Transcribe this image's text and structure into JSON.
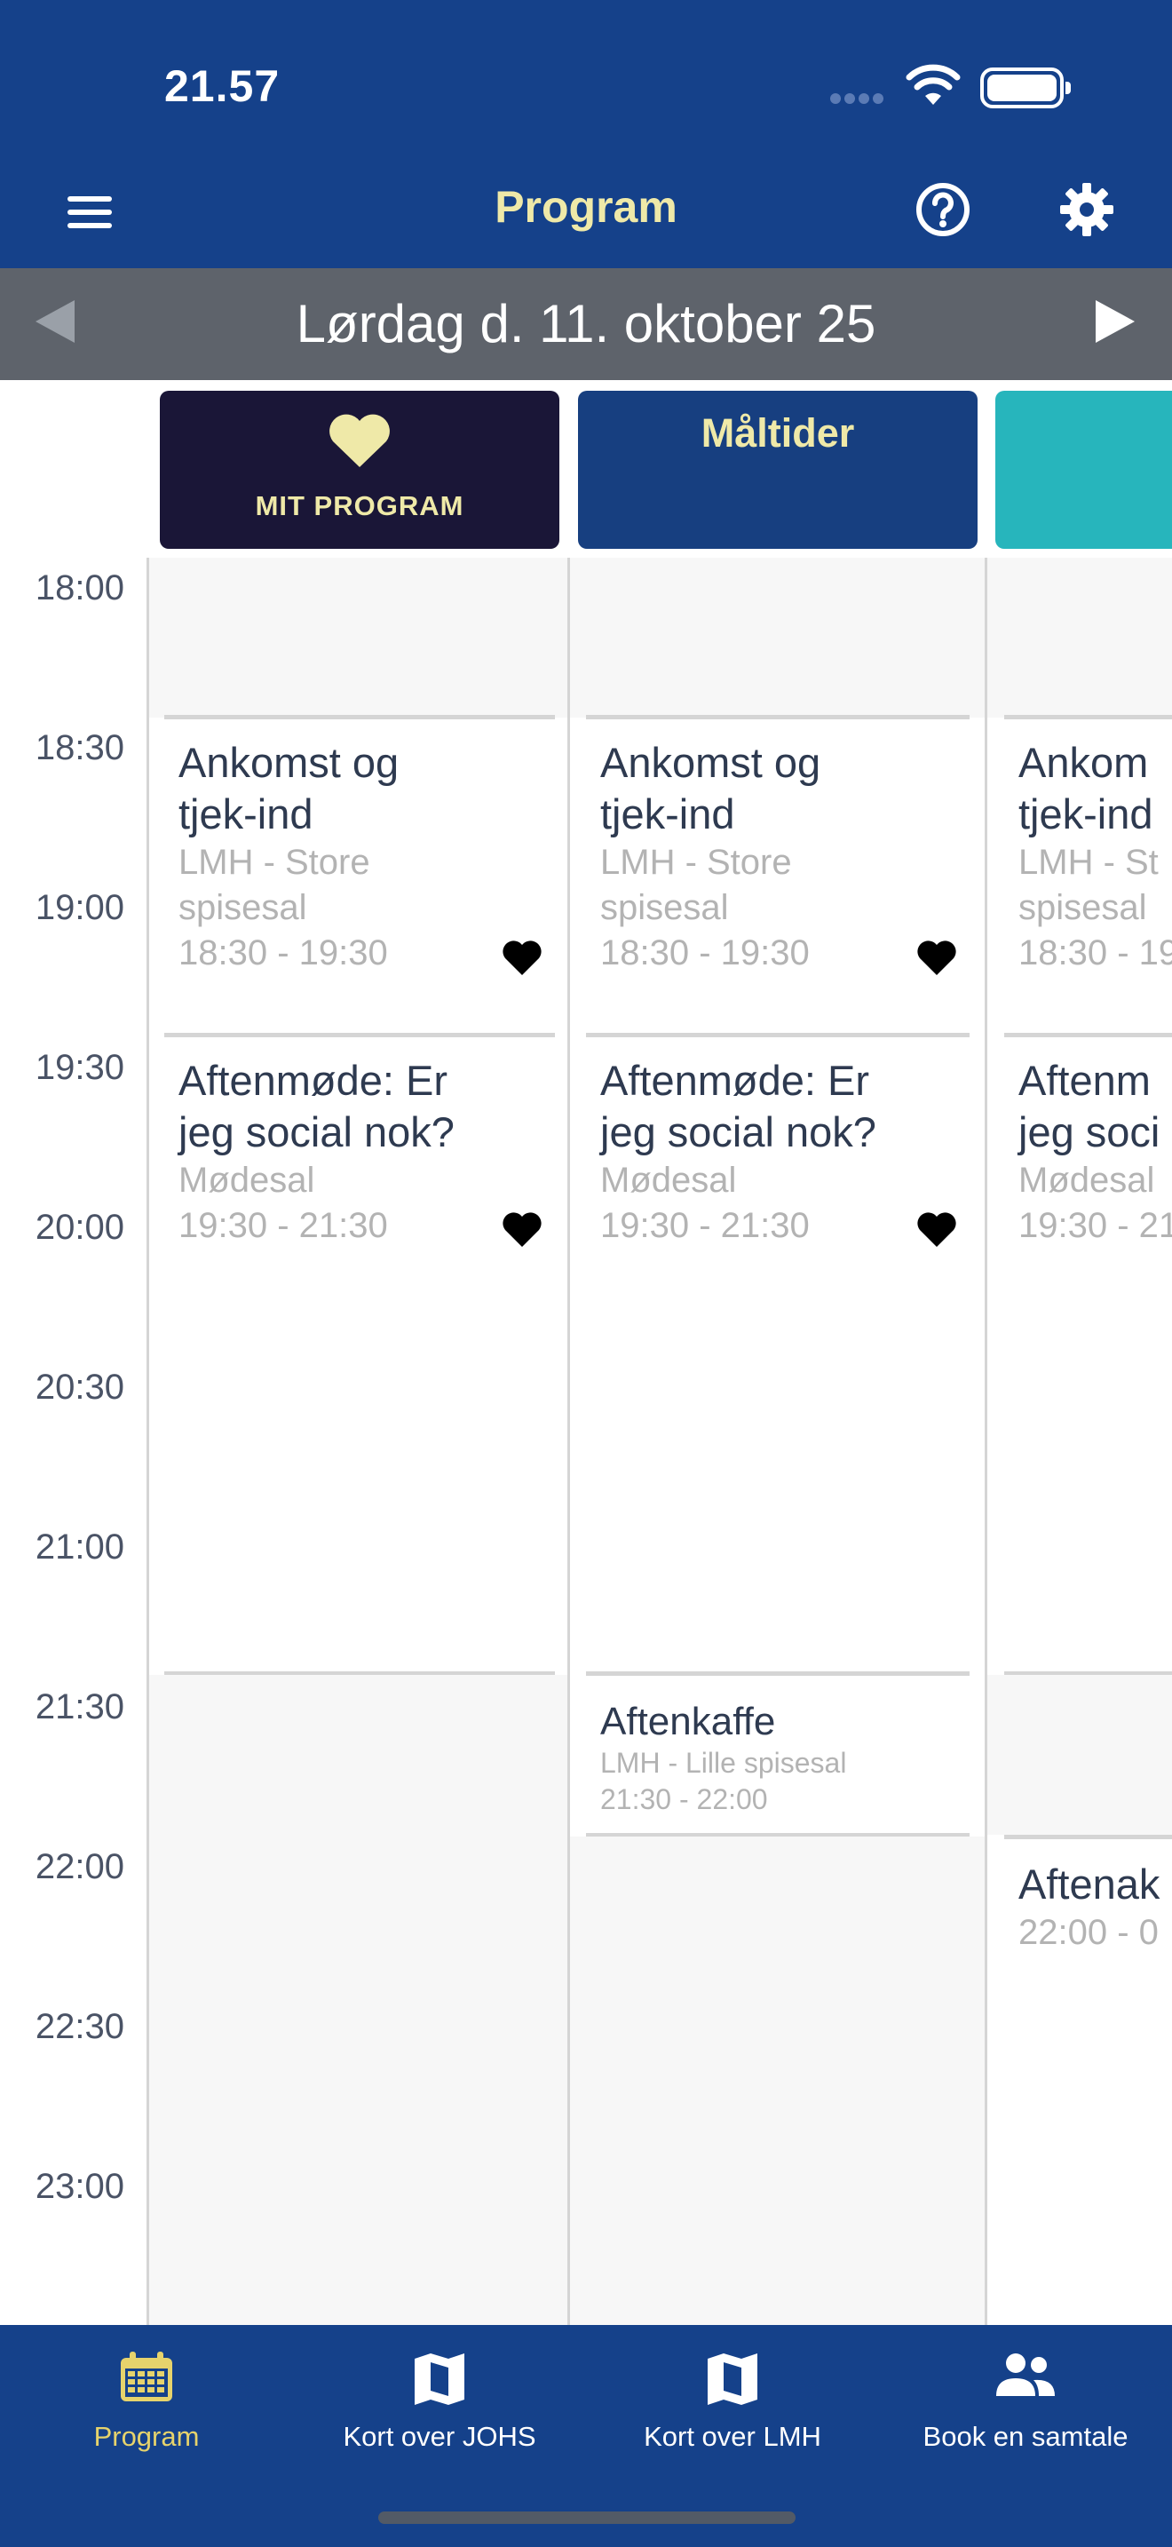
{
  "status_bar": {
    "time": "21.57"
  },
  "app_bar": {
    "title": "Program",
    "menu_icon": "hamburger-menu-icon",
    "help_icon": "help-circle-icon",
    "settings_icon": "gear-icon"
  },
  "date_nav": {
    "date": "Lørdag d. 11. oktober 25",
    "prev_icon": "triangle-left-icon",
    "next_icon": "triangle-right-icon"
  },
  "tabs": [
    {
      "label": "MIT PROGRAM",
      "icon": "heart-icon",
      "color": "#1a1637"
    },
    {
      "label": "Måltider",
      "color": "#173f80"
    },
    {
      "label": "",
      "color": "#27b5bc"
    }
  ],
  "time_axis": [
    "18:00",
    "18:30",
    "19:00",
    "19:30",
    "20:00",
    "20:30",
    "21:00",
    "21:30",
    "22:00",
    "22:30",
    "23:00"
  ],
  "columns": [
    {
      "events": [
        {
          "title_1": "Ankomst og",
          "title_2": "tjek-ind",
          "location_1": "LMH - Store",
          "location_2": "spisesal",
          "time": "18:30 - 19:30",
          "favorite": true
        },
        {
          "title_1": "Aftenmøde: Er",
          "title_2": "jeg social nok?",
          "location_1": "Mødesal",
          "time": "19:30 - 21:30",
          "favorite": true
        }
      ]
    },
    {
      "events": [
        {
          "title_1": "Ankomst og",
          "title_2": "tjek-ind",
          "location_1": "LMH - Store",
          "location_2": "spisesal",
          "time": "18:30 - 19:30",
          "favorite": true
        },
        {
          "title_1": "Aftenmøde: Er",
          "title_2": "jeg social nok?",
          "location_1": "Mødesal",
          "time": "19:30 - 21:30",
          "favorite": true
        },
        {
          "title_1": "Aftenkaffe",
          "location_1": "LMH - Lille spisesal",
          "time": "21:30 - 22:00"
        }
      ]
    },
    {
      "events": [
        {
          "title_1": "Ankom",
          "title_2": "tjek-ind",
          "location_1": "LMH - St",
          "location_2": "spisesal",
          "time": "18:30 - 19"
        },
        {
          "title_1": "Aftenm",
          "title_2": "jeg soci",
          "location_1": "Mødesal",
          "time": "19:30 - 21"
        },
        {
          "title_1": "Aftenak",
          "time": "22:00 - 0"
        }
      ]
    }
  ],
  "bottom_nav": [
    {
      "label": "Program",
      "icon": "calendar-icon",
      "active": true
    },
    {
      "label": "Kort over JOHS",
      "icon": "map-icon"
    },
    {
      "label": "Kort over LMH",
      "icon": "map-icon"
    },
    {
      "label": "Book en samtale",
      "icon": "people-icon"
    }
  ],
  "colors": {
    "primary": "#15418a",
    "accent": "#efe9a8",
    "active_nav": "#e6d36c",
    "date_bar": "#5e636b",
    "teal": "#27b5bc"
  }
}
